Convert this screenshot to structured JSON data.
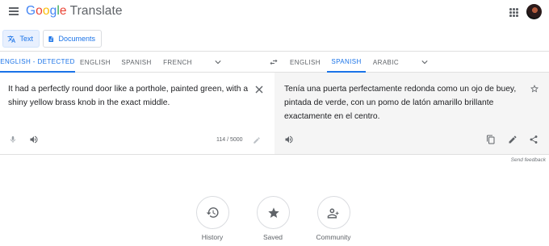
{
  "header": {
    "brand_letters": [
      "G",
      "o",
      "o",
      "g",
      "l",
      "e"
    ],
    "product": "Translate",
    "icons": {
      "menu": "menu-icon",
      "apps": "apps-grid-icon",
      "avatar": "user-avatar"
    }
  },
  "modes": {
    "text_label": "Text",
    "documents_label": "Documents",
    "active": "text"
  },
  "source_langs": [
    "ENGLISH - DETECTED",
    "ENGLISH",
    "SPANISH",
    "FRENCH"
  ],
  "target_langs": [
    "ENGLISH",
    "SPANISH",
    "ARABIC"
  ],
  "active_source": "ENGLISH - DETECTED",
  "active_target": "SPANISH",
  "source": {
    "text": "It had a perfectly round door like a porthole, painted green, with a shiny yellow brass knob in the exact middle.",
    "char_count": "114 / 5000"
  },
  "target": {
    "text": "Tenía una puerta perfectamente redonda como un ojo de buey, pintada de verde, con un pomo de latón amarillo brillante exactamente en el centro."
  },
  "feedback_label": "Send feedback",
  "bottom_actions": {
    "history": "History",
    "saved": "Saved",
    "community": "Community"
  },
  "colors": {
    "accent": "#1a73e8",
    "active_chip_bg": "#e8f0fe",
    "target_panel_bg": "#f5f5f5",
    "icon_gray": "#5f6368"
  }
}
